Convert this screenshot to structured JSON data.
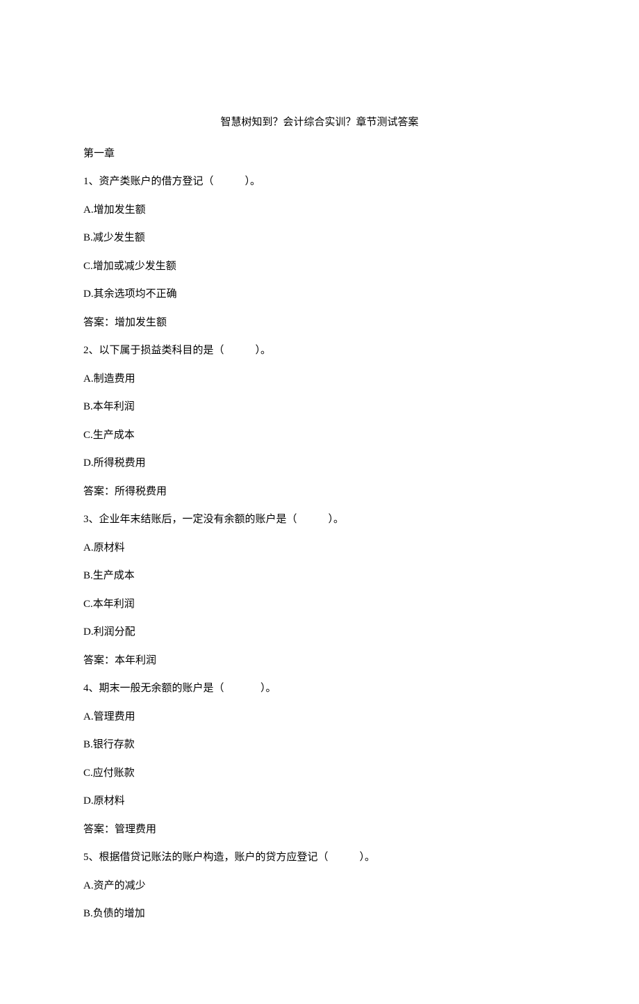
{
  "title": "智慧树知到？会计综合实训？章节测试答案",
  "chapter_heading": "第一章",
  "questions": [
    {
      "q_line": "1、资产类账户的借方登记（            ）。",
      "options": [
        "A.增加发生额",
        "B.减少发生额",
        "C.增加或减少发生额",
        "D.其余选项均不正确"
      ],
      "answer": "答案：增加发生额"
    },
    {
      "q_line": "2、以下属于损益类科目的是（            ）。",
      "options": [
        "A.制造费用",
        "B.本年利润",
        "C.生产成本",
        "D.所得税费用"
      ],
      "answer": "答案：所得税费用"
    },
    {
      "q_line": "3、企业年末结账后，一定没有余额的账户是（            ）。",
      "options": [
        "A.原材料",
        "B.生产成本",
        "C.本年利润",
        "D.利润分配"
      ],
      "answer": "答案：本年利润"
    },
    {
      "q_line": "4、期末一般无余额的账户是（              ）。",
      "options": [
        "A.管理费用",
        "B.银行存款",
        "C.应付账款",
        "D.原材料"
      ],
      "answer": "答案：管理费用"
    },
    {
      "q_line": "5、根据借贷记账法的账户构造，账户的贷方应登记（            ）。",
      "options": [
        "A.资产的减少",
        "B.负债的增加"
      ],
      "answer": ""
    }
  ]
}
